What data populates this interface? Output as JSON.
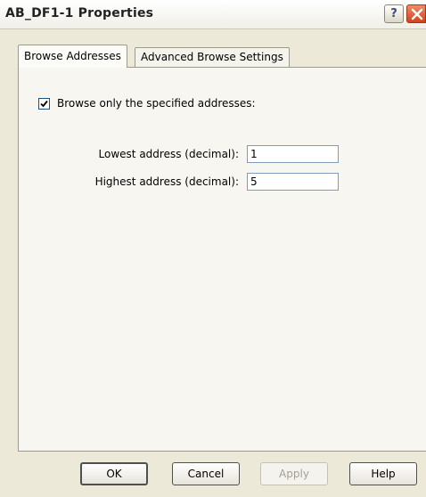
{
  "window": {
    "title": "AB_DF1-1 Properties",
    "help_glyph": "?"
  },
  "tabs": [
    {
      "label": "Browse Addresses",
      "selected": true
    },
    {
      "label": "Advanced Browse Settings",
      "selected": false
    }
  ],
  "browse": {
    "only_specified_label": "Browse only the specified addresses:",
    "only_specified_checked": true,
    "lowest_label": "Lowest address (decimal):",
    "lowest_value": "1",
    "highest_label": "Highest address (decimal):",
    "highest_value": "5"
  },
  "buttons": {
    "ok": "OK",
    "cancel": "Cancel",
    "apply": "Apply",
    "help": "Help"
  },
  "icons": {
    "help": "question-icon",
    "close": "close-icon",
    "check": "check-icon"
  },
  "colors": {
    "dialog_bg": "#ece9d8",
    "close_red": "#d2421c",
    "input_border": "#7f9db9"
  }
}
